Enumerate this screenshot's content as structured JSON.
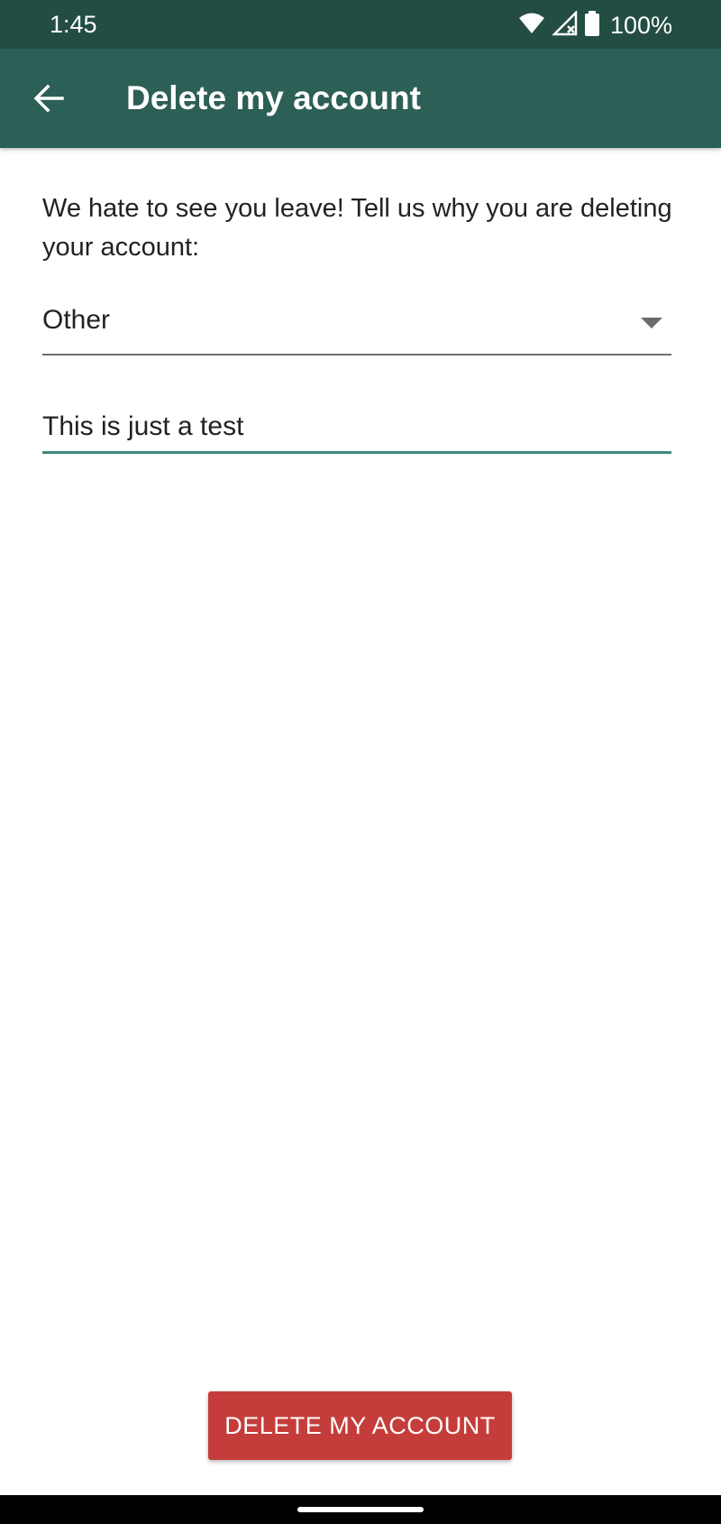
{
  "status_bar": {
    "time": "1:45",
    "battery": "100%",
    "icons": [
      "wifi-icon",
      "signal-icon",
      "battery-icon"
    ]
  },
  "app_bar": {
    "title": "Delete my account",
    "back_icon": "arrow-left-icon"
  },
  "form": {
    "prompt": "We hate to see you leave! Tell us why you are deleting your account:",
    "reason_selected": "Other",
    "comment_value": "This is just a test"
  },
  "actions": {
    "delete_label": "DELETE MY ACCOUNT"
  },
  "colors": {
    "status_bar": "#234d42",
    "app_bar": "#2c5f55",
    "accent": "#3f8a7b",
    "danger": "#c53d3a"
  }
}
